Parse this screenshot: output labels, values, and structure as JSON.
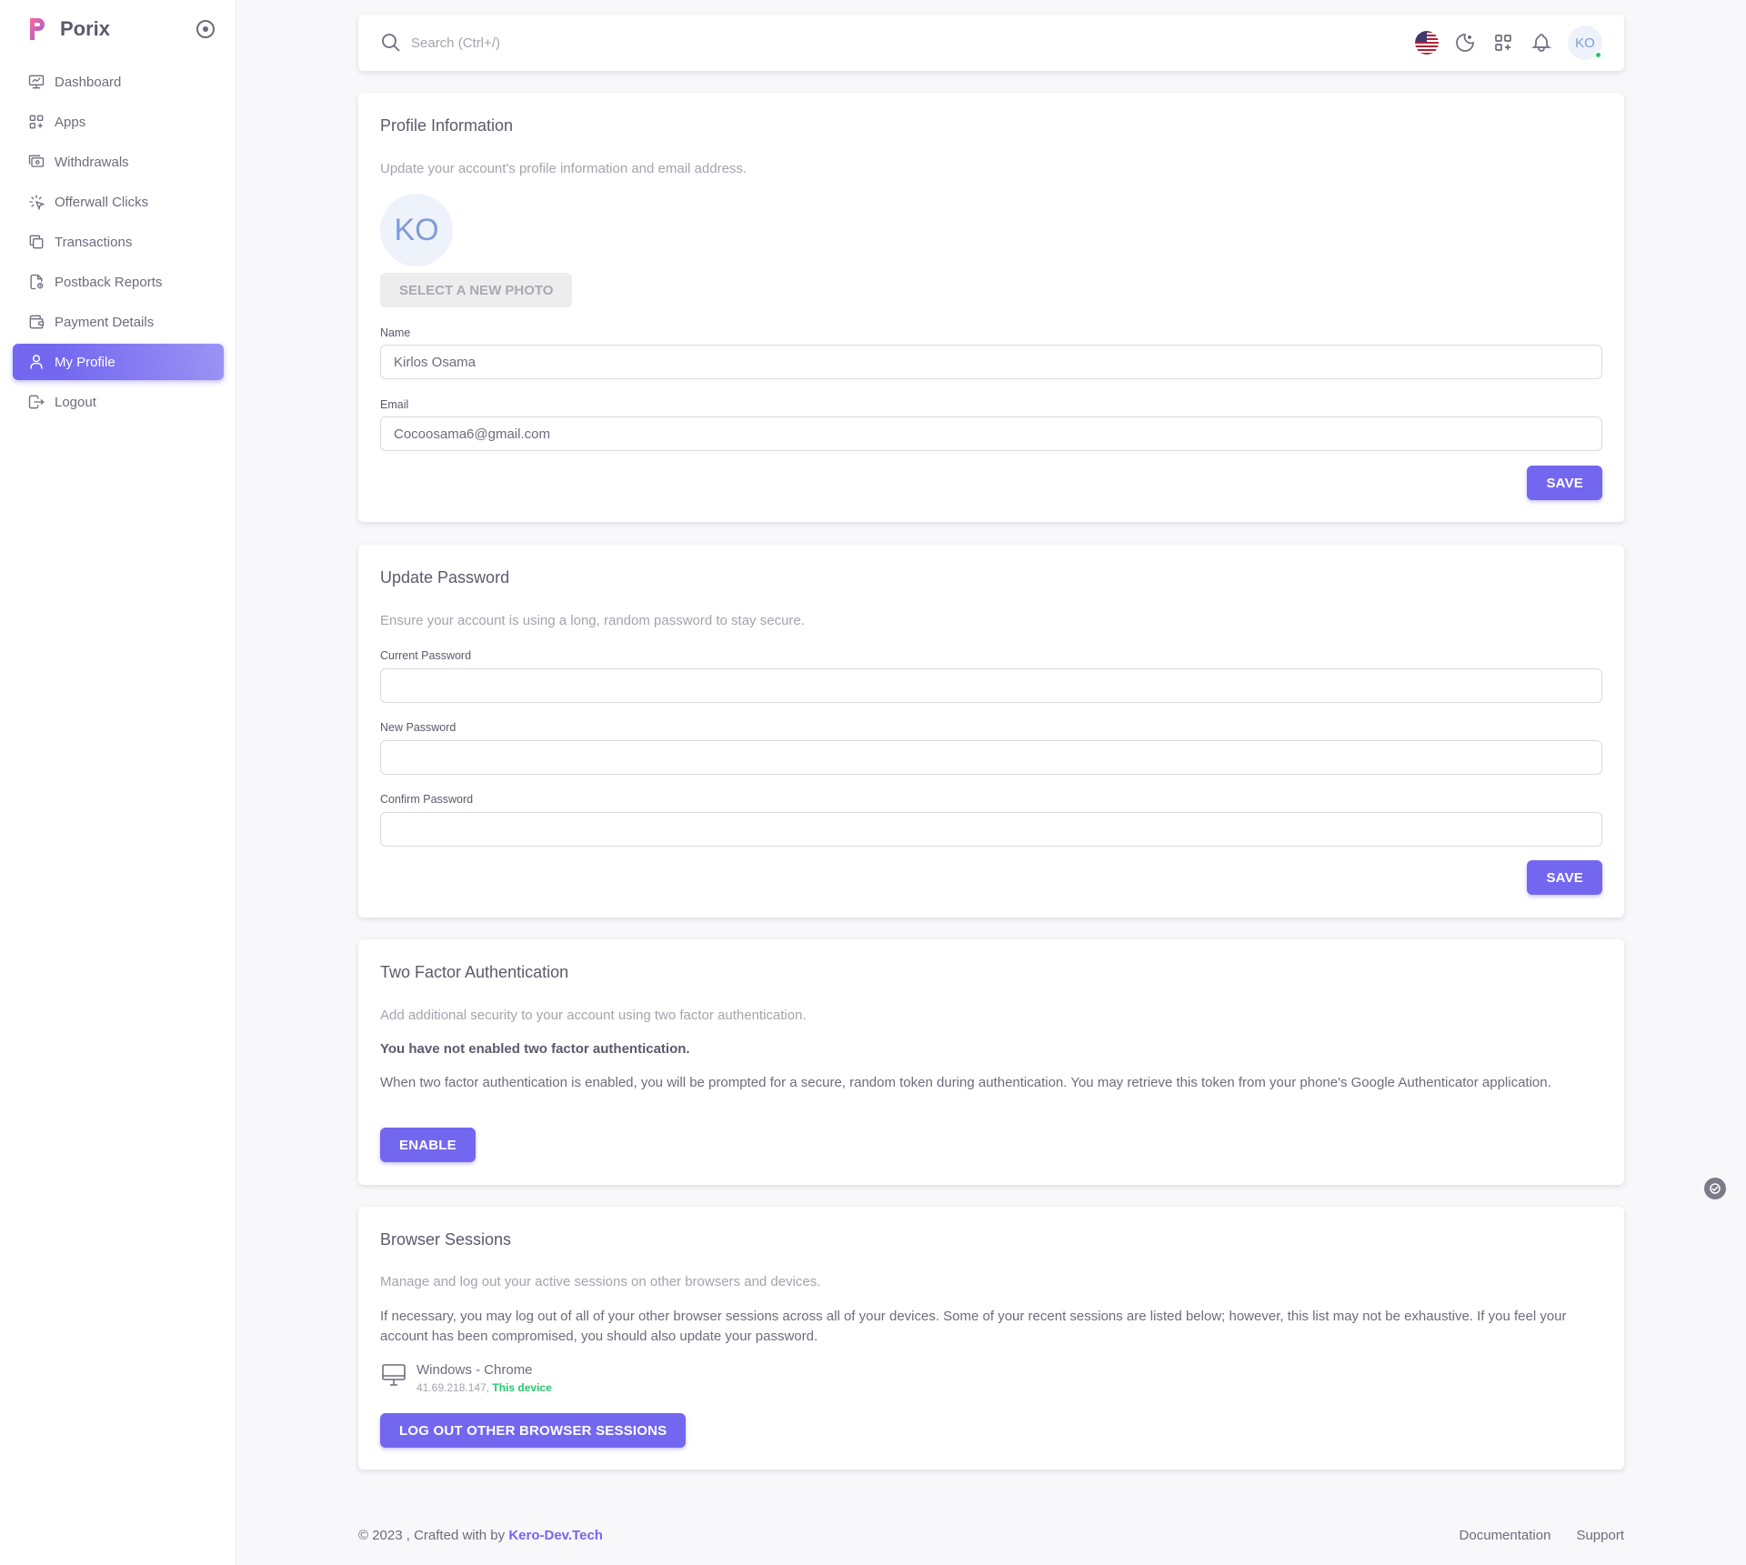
{
  "brand": {
    "name": "Porix"
  },
  "sidebar": {
    "items": [
      {
        "label": "Dashboard",
        "icon": "dashboard-icon"
      },
      {
        "label": "Apps",
        "icon": "apps-icon"
      },
      {
        "label": "Withdrawals",
        "icon": "withdrawals-icon"
      },
      {
        "label": "Offerwall Clicks",
        "icon": "click-icon"
      },
      {
        "label": "Transactions",
        "icon": "transactions-icon"
      },
      {
        "label": "Postback Reports",
        "icon": "report-icon"
      },
      {
        "label": "Payment Details",
        "icon": "wallet-icon"
      },
      {
        "label": "My Profile",
        "icon": "user-icon",
        "active": true
      },
      {
        "label": "Logout",
        "icon": "logout-icon"
      }
    ]
  },
  "navbar": {
    "search_placeholder": "Search (Ctrl+/)",
    "avatar_initials": "KO"
  },
  "profile": {
    "title": "Profile Information",
    "subtitle": "Update your account's profile information and email address.",
    "avatar_initials": "KO",
    "photo_button": "SELECT A NEW PHOTO",
    "name_label": "Name",
    "name_value": "Kirlos Osama",
    "email_label": "Email",
    "email_value": "Cocoosama6@gmail.com",
    "save_label": "SAVE"
  },
  "password": {
    "title": "Update Password",
    "subtitle": "Ensure your account is using a long, random password to stay secure.",
    "current_label": "Current Password",
    "new_label": "New Password",
    "confirm_label": "Confirm Password",
    "save_label": "SAVE"
  },
  "twofa": {
    "title": "Two Factor Authentication",
    "subtitle": "Add additional security to your account using two factor authentication.",
    "status": "You have not enabled two factor authentication.",
    "description": "When two factor authentication is enabled, you will be prompted for a secure, random token during authentication. You may retrieve this token from your phone's Google Authenticator application.",
    "enable_label": "ENABLE"
  },
  "sessions": {
    "title": "Browser Sessions",
    "subtitle": "Manage and log out your active sessions on other browsers and devices.",
    "description": "If necessary, you may log out of all of your other browser sessions across all of your devices. Some of your recent sessions are listed below; however, this list may not be exhaustive. If you feel your account has been compromised, you should also update your password.",
    "device": "Windows - Chrome",
    "ip": "41.69.218.147,",
    "this_device": "This device",
    "logout_label": "LOG OUT OTHER BROWSER SESSIONS"
  },
  "footer": {
    "copyright": "© 2023 , Crafted with by ",
    "author": "Kero-Dev.Tech",
    "documentation": "Documentation",
    "support": "Support"
  },
  "colors": {
    "primary": "#7367f0",
    "success": "#28c76f",
    "text": "#5d596c",
    "muted": "#a5a3ae"
  }
}
